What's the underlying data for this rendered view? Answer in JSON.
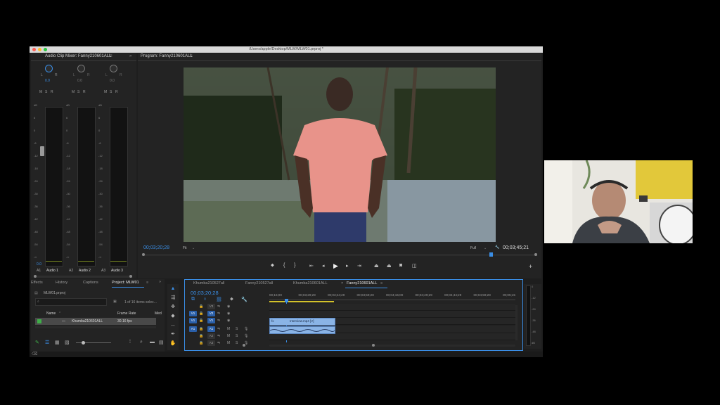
{
  "window": {
    "title": "/Users/apple/Desktop/MLW/MLW01.prproj *",
    "colors": {
      "close": "#ff5f57",
      "minimize": "#febc2e",
      "zoom": "#28c840",
      "accent": "#3a8ee6"
    }
  },
  "audio_mixer": {
    "title": "Audio Clip Mixer: Fanny210601ALL",
    "channels": [
      {
        "pan": "0.0",
        "lr_label": "L",
        "lr_label_r": "R",
        "id": "A1",
        "name": "Audio 1"
      },
      {
        "pan": "0.0",
        "lr_label": "L",
        "lr_label_r": "R",
        "id": "A2",
        "name": "Audio 2"
      },
      {
        "pan": "0.0",
        "lr_label": "L",
        "lr_label_r": "R",
        "id": "A3",
        "name": "Audio 3"
      }
    ],
    "msr": [
      "M",
      "S",
      "R"
    ],
    "db_scale": [
      "dB",
      "6",
      "0",
      "-6",
      "-12",
      "-18",
      "-24",
      "-30",
      "-36",
      "-42",
      "-48",
      "-54",
      "-∞"
    ],
    "fader_value": "0.0"
  },
  "program_monitor": {
    "title": "Program: Fanny210601ALL",
    "current_time": "00;03;20;28",
    "fit_label": "Fit",
    "resolution": "Full",
    "duration": "00;03;45;21"
  },
  "project_panel": {
    "tabs": [
      "Effects",
      "History",
      "Captions",
      "Project: MLW01"
    ],
    "file": "MLW01.prproj",
    "selection_info": "1 of 16 items selec...",
    "columns": {
      "name": "Name",
      "frame_rate": "Frame Rate",
      "media": "Med"
    },
    "rows": [
      {
        "name": "Khumba210601ALL",
        "frame_rate": "30.16 fps"
      }
    ]
  },
  "timeline": {
    "tabs": [
      "Khumba210527all",
      "Fanny210527all",
      "Khumba210601ALL",
      "Fanny210601ALL"
    ],
    "active_tab": 3,
    "timecode": "00;03;20;28",
    "ruler": [
      "00;15;00",
      "00;03;29;29",
      "00;03;44;29",
      "00;03;59;28",
      "00;04;15;00",
      "00;04;29;29",
      "00;04;44;29",
      "00;04;59;28",
      "00;05;15"
    ],
    "video_tracks": [
      {
        "src": "",
        "dst": "V3"
      },
      {
        "src": "V1",
        "dst": "V2"
      },
      {
        "src": "V1",
        "dst": "V1"
      }
    ],
    "audio_tracks": [
      {
        "src": "A1",
        "dst": "A1",
        "m": "M",
        "s": "S"
      },
      {
        "src": "",
        "dst": "A2",
        "m": "M",
        "s": "S"
      },
      {
        "src": "",
        "dst": "A3",
        "m": "M",
        "s": "S"
      }
    ],
    "clip_label": "Interview.mp4 [V]",
    "meter_scale": [
      "0",
      "-12",
      "-24",
      "-36",
      "-48",
      "dB"
    ]
  }
}
